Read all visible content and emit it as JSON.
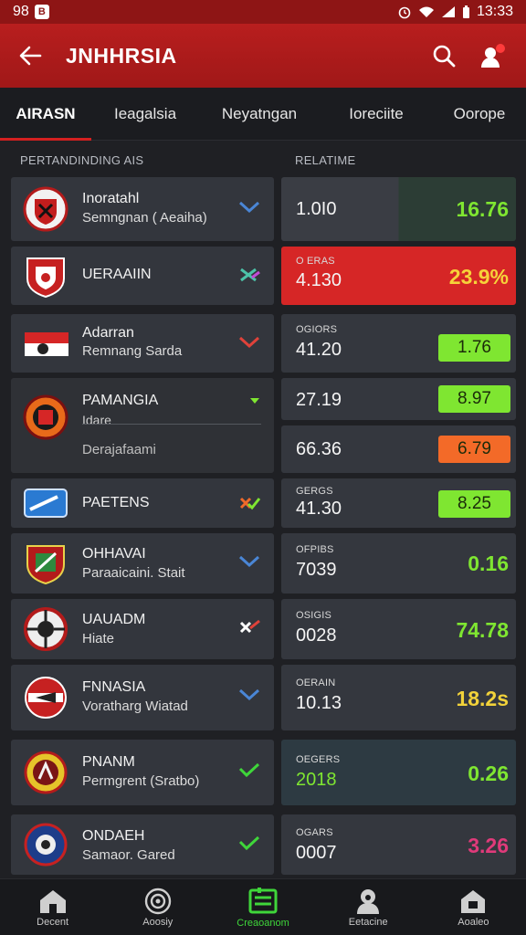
{
  "status_bar": {
    "left": "98",
    "time": "13:33"
  },
  "app_bar": {
    "title": "JNHHRSIA"
  },
  "tabs": [
    "AIRASN",
    "Ieagalsia",
    "Neyatngan",
    "Ioreciite",
    "Oorope"
  ],
  "sections": {
    "left": "PERTANDINDING AIS",
    "right": "RELATIME"
  },
  "matches": [
    {
      "team": "Inoratahl",
      "team2": "Semngnan ( Aeaiha)",
      "value": "1.0I0",
      "odds": "16.76"
    },
    {
      "team": "UERAAIIN",
      "label": "O ERAS",
      "value": "4.130",
      "odds": "23.9%"
    },
    {
      "team": "Adarran",
      "team2": "Remnang Sarda",
      "label": "OGIORS",
      "value": "41.20",
      "odds": "1.76"
    },
    {
      "team": "PAMANGIA",
      "team2": "Idare",
      "team3": "Derajafaami",
      "value": "27.19",
      "odds": "8.97",
      "value_b": "66.36",
      "odds_b": "6.79"
    },
    {
      "team": "PAETENS",
      "label": "GERGS",
      "value": "41.30",
      "odds": "8.25"
    },
    {
      "team": "OHHAVAI",
      "team2": "Paraaicaini. Stait",
      "label": "OFPIBS",
      "value": "7039",
      "odds": "0.16"
    },
    {
      "team": "UAUADM",
      "team2": "Hiate",
      "label": "OSIGIS",
      "value": "0028",
      "odds": "74.78"
    },
    {
      "team": "FNNASIA",
      "team2": "Voratharg Wiatad",
      "label": "OERAIN",
      "value": "10.13",
      "odds": "18.2s"
    },
    {
      "team": "PNANM",
      "team2": "Permgrent (Sratbo)",
      "label": "OEGERS",
      "value": "2018",
      "odds": "0.26"
    },
    {
      "team": "ONDAEH",
      "team2": "Samaor. Gared",
      "label": "OGARS",
      "value": "0007",
      "odds": "3.26"
    }
  ],
  "bottom_nav": [
    "Decent",
    "Aoosiy",
    "Creaoanom",
    "Eetacine",
    "Aoaleo"
  ],
  "colors": {
    "accent": "#b81e1e",
    "green": "#7fe631",
    "red": "#d62626",
    "orange": "#f36a28"
  }
}
